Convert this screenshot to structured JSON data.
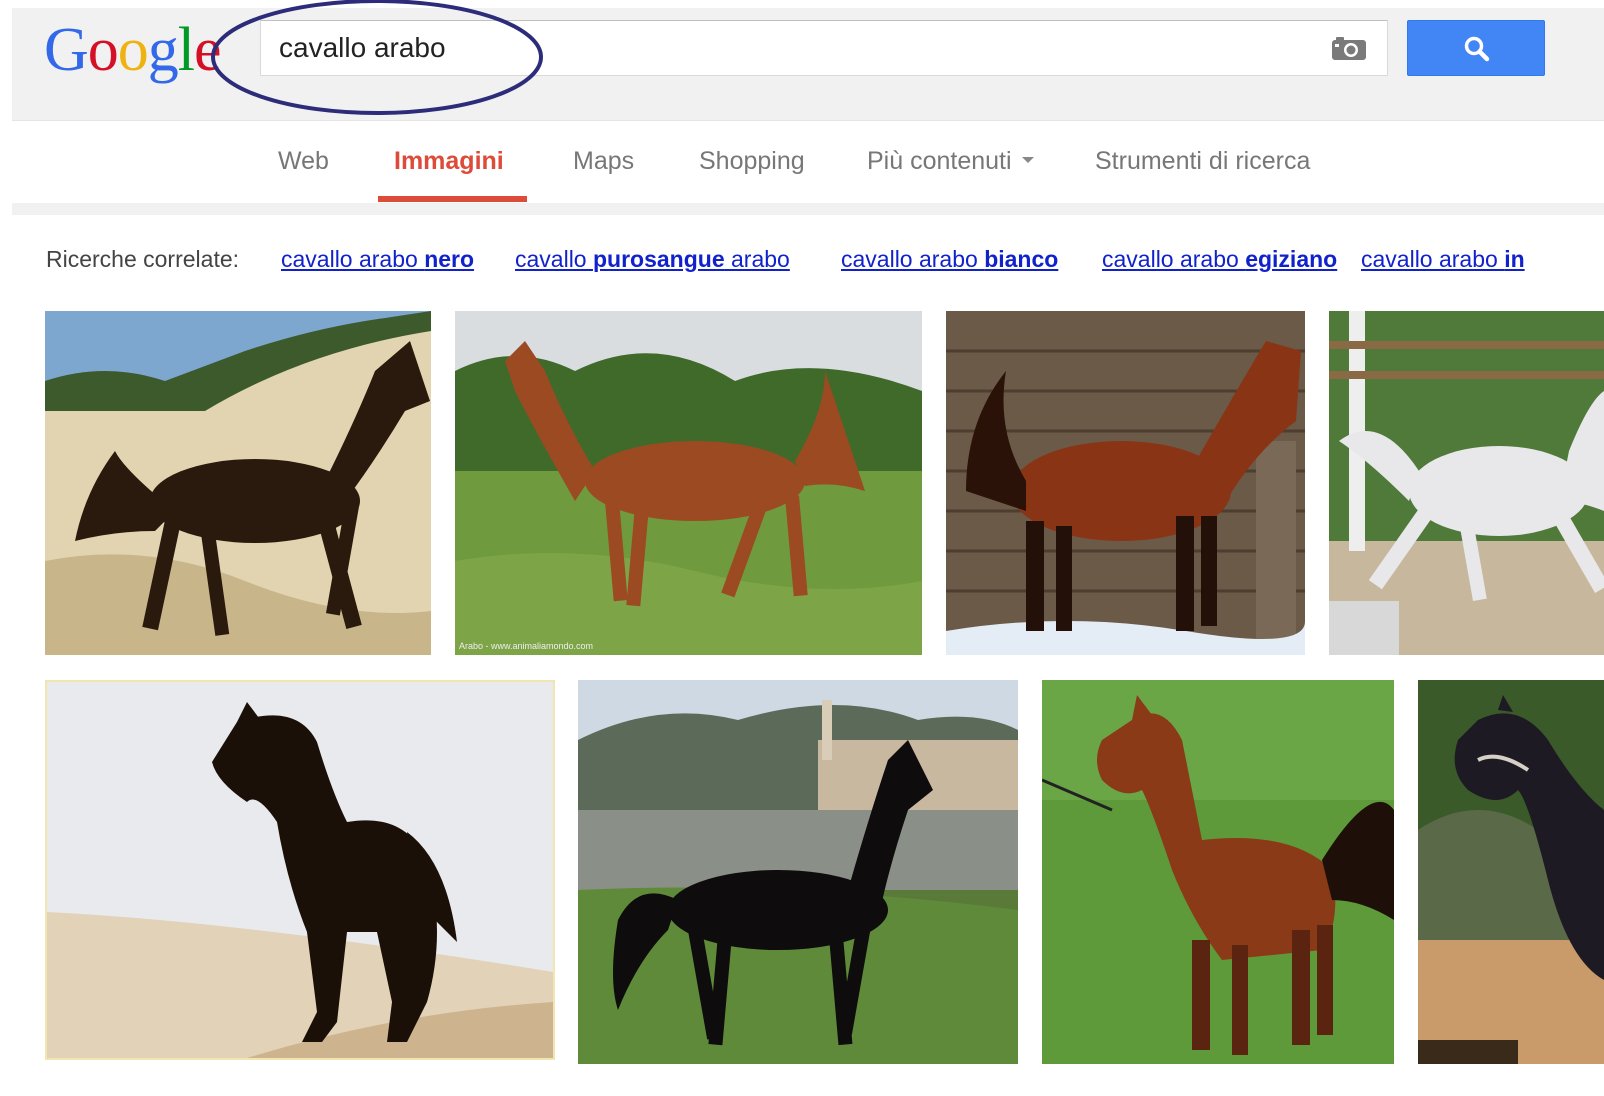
{
  "logo": {
    "letters": [
      "G",
      "o",
      "o",
      "g",
      "l",
      "e"
    ],
    "colors": [
      "#3369e8",
      "#d50f25",
      "#eeb211",
      "#3369e8",
      "#009925",
      "#d50f25"
    ]
  },
  "search": {
    "query": "cavallo arabo",
    "camera_icon": "camera-icon",
    "button_icon": "search-icon",
    "button_color": "#4285f4"
  },
  "tabs": [
    {
      "label": "Web",
      "active": false
    },
    {
      "label": "Immagini",
      "active": true
    },
    {
      "label": "Maps",
      "active": false
    },
    {
      "label": "Shopping",
      "active": false
    },
    {
      "label": "Più contenuti",
      "active": false,
      "dropdown": true
    },
    {
      "label": "Strumenti di ricerca",
      "active": false
    }
  ],
  "related": {
    "label": "Ricerche correlate:",
    "links": [
      {
        "plain_before": "cavallo arabo ",
        "bold": "nero",
        "plain_after": ""
      },
      {
        "plain_before": "cavallo ",
        "bold": "purosangue",
        "plain_after": " arabo"
      },
      {
        "plain_before": "cavallo arabo ",
        "bold": "bianco",
        "plain_after": ""
      },
      {
        "plain_before": "cavallo arabo ",
        "bold": "egiziano",
        "plain_after": ""
      },
      {
        "plain_before": "cavallo arabo ",
        "bold": "in",
        "plain_after": ""
      }
    ]
  },
  "annotation": {
    "color": "#2c2c7a"
  },
  "results": [
    {
      "subject": "dark bay arabian horse on sand"
    },
    {
      "subject": "chestnut arabian horse trotting in field"
    },
    {
      "subject": "bay arabian horse by wooden wall"
    },
    {
      "subject": "grey arabian horse trotting"
    },
    {
      "subject": "black arabian horse silhouette in desert"
    },
    {
      "subject": "black arabian horse by village"
    },
    {
      "subject": "bay arabian horse on grass"
    },
    {
      "subject": "black arabian horse with halter"
    }
  ],
  "watermark_text": "Arabo - www.animaliamondo.com"
}
